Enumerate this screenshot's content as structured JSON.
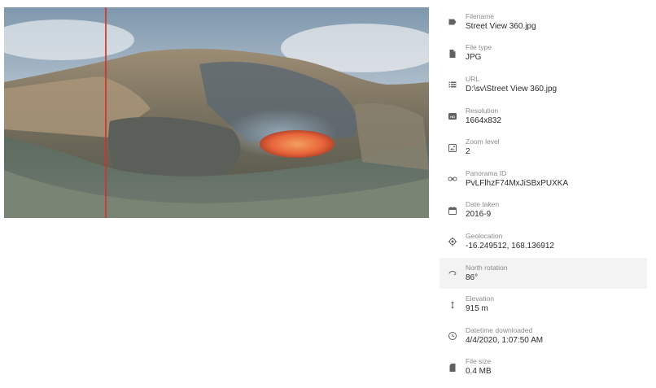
{
  "preview": {
    "colors": {
      "north_line": "#d0342c",
      "lava": "#e8653a",
      "sky": "#c9d3dc"
    }
  },
  "properties": [
    {
      "id": "filename",
      "icon": "label-icon",
      "label": "Filename",
      "value": "Street View 360.jpg"
    },
    {
      "id": "file-type",
      "icon": "file-icon",
      "label": "File type",
      "value": "JPG"
    },
    {
      "id": "url",
      "icon": "list-icon",
      "label": "URL",
      "value": "D:\\sv\\Street View 360.jpg"
    },
    {
      "id": "resolution",
      "icon": "hd-icon",
      "label": "Resolution",
      "value": "1664x832"
    },
    {
      "id": "zoom-level",
      "icon": "zoom-image-icon",
      "label": "Zoom level",
      "value": "2"
    },
    {
      "id": "panorama-id",
      "icon": "link-icon",
      "label": "Panorama ID",
      "value": "PvLFlhzF74MxJiSBxPUXKA"
    },
    {
      "id": "date-taken",
      "icon": "calendar-icon",
      "label": "Date taken",
      "value": "2016-9"
    },
    {
      "id": "geolocation",
      "icon": "gps-icon",
      "label": "Geolocation",
      "value": "-16.249512, 168.136912"
    },
    {
      "id": "north-rotation",
      "icon": "rotation-icon",
      "label": "North rotation",
      "value": "86°"
    },
    {
      "id": "elevation",
      "icon": "vertical-arrows-icon",
      "label": "Elevation",
      "value": "915 m"
    },
    {
      "id": "datetime-downloaded",
      "icon": "clock-icon",
      "label": "Datetime downloaded",
      "value": "4/4/2020, 1:07:50 AM"
    },
    {
      "id": "file-size",
      "icon": "sd-card-icon",
      "label": "File size",
      "value": "0.4 MB"
    }
  ]
}
